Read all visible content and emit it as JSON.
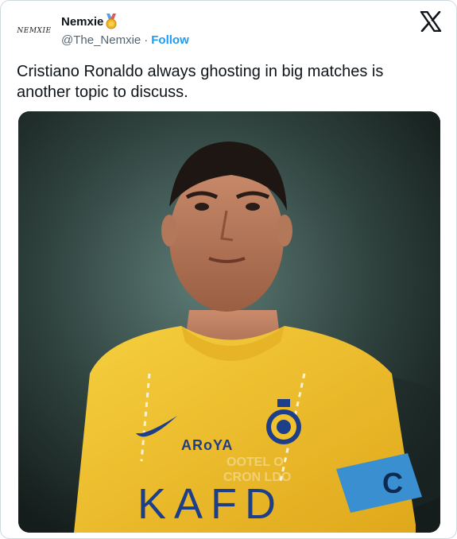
{
  "author": {
    "avatar_text": "NEMXIE",
    "name": "Nemxie",
    "handle": "@The_Nemxie",
    "separator": "·",
    "follow_label": "Follow"
  },
  "tweet": {
    "text": "Cristiano Ronaldo always ghosting in big matches is another topic to discuss."
  },
  "media": {
    "sponsor_text": "ARoYA",
    "shirt_text": "KAFD",
    "armband_text": "C",
    "watermark_line1": "OOTEL  O",
    "watermark_line2": "CRON  LDO",
    "colors": {
      "jersey": "#f2c22c",
      "armband": "#3a8fd0",
      "trim": "#1d3f8a"
    }
  },
  "icons": {
    "medal": "medal-icon",
    "x_logo": "x-logo-icon"
  }
}
